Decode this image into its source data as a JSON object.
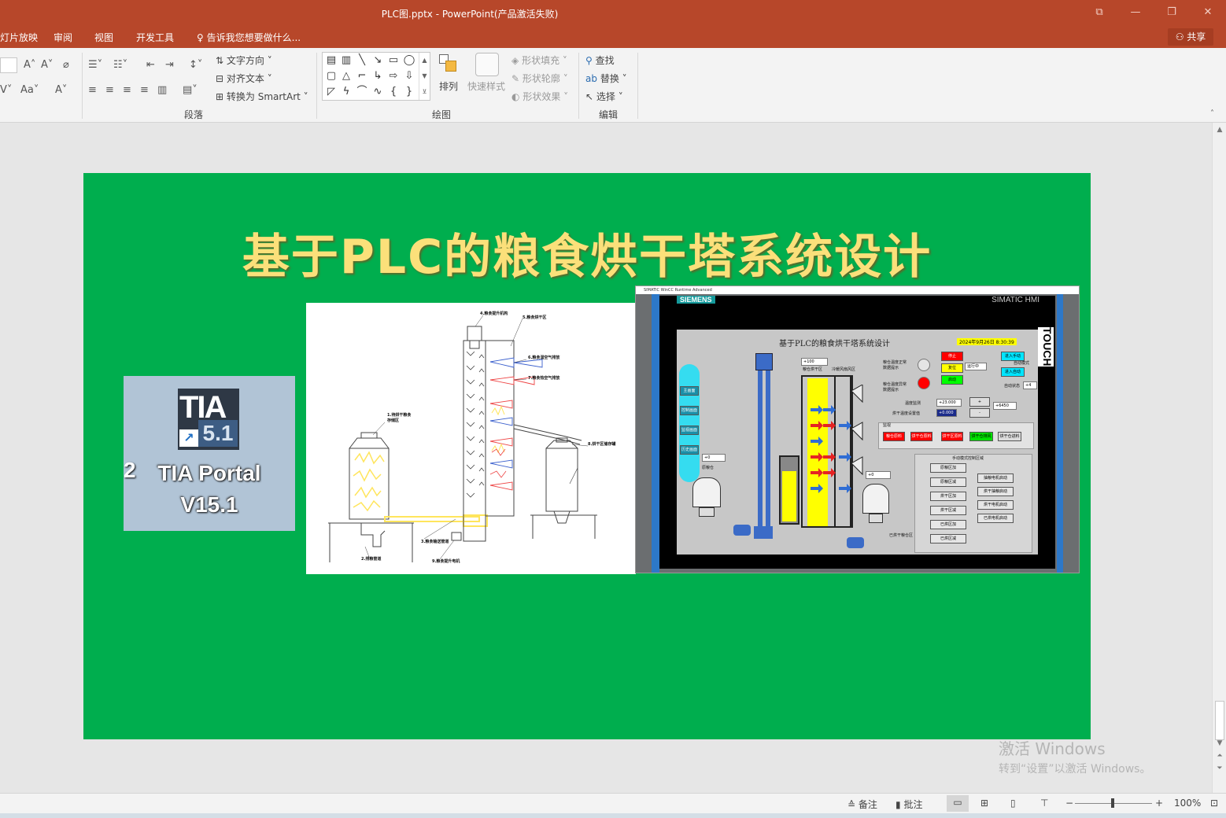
{
  "window": {
    "title": "PLC图.pptx - PowerPoint(产品激活失败)",
    "controls": [
      "⧉",
      "—",
      "❐",
      "✕"
    ]
  },
  "menu": {
    "tabs": [
      "幻灯片放映",
      "审阅",
      "视图",
      "开发工具"
    ],
    "tell_me": "告诉我您想要做什么...",
    "share": "共享"
  },
  "ribbon": {
    "paragraph": {
      "text_direction": "文字方向",
      "align_text": "对齐文本",
      "smartart": "转换为 SmartArt",
      "group_label": "段落"
    },
    "drawing": {
      "arrange": "排列",
      "quick_styles": "快速样式",
      "shape_fill": "形状填充",
      "shape_outline": "形状轮廓",
      "shape_effects": "形状效果",
      "group_label": "绘图"
    },
    "editing": {
      "find": "查找",
      "replace": "替换",
      "select": "选择",
      "group_label": "编辑"
    }
  },
  "slide": {
    "title": "基于PLC的粮食烘干塔系统设计",
    "tia": {
      "logo_text": "TIA",
      "logo_version": "5.1",
      "label_line1": "TIA Portal",
      "label_line2": "V15.1",
      "left_char": "2"
    },
    "diagram_labels": {
      "l4": "4.粮食提升机构",
      "l5": "5.粮食烘干区",
      "l6": "6.粮食湿空气排放",
      "l7": "7.粮食热空气排放",
      "l1a": "1.待烘干粮食",
      "l1b": "存储区",
      "l8": "8.烘干区储存罐",
      "l3": "3.粮食输送管道",
      "l2": "2.排粮管道",
      "l9": "9.粮食提升电机"
    },
    "hmi": {
      "window_title": "SIMATIC WinCC Runtime Advanced",
      "siemens": "SIEMENS",
      "simatic": "SIMATIC HMI",
      "touch": "TOUCH",
      "screen_title": "基于PLC的粮食烘干塔系统设计",
      "datetime": "2024年9月26日 8:30:39",
      "nav": [
        "主画面",
        "控制画面",
        "监视画面",
        "历史画面"
      ],
      "field_top": "+100",
      "zone_label": "粮仓烘干区",
      "fan_label": "冷暖风扇风区",
      "temp_normal": "粮仓温度正常",
      "temp_normal2": "数据提示",
      "temp_abnormal": "粮仓温度异常",
      "temp_abnormal2": "数据提示",
      "btn_stop": "停止",
      "btn_reset": "复位",
      "btn_start": "启动",
      "run_status": "运行中",
      "btn_manual": "进入手动",
      "btn_auto": "进入自动",
      "auto_mode": "自动模式",
      "auto_status": "自动状态",
      "auto_value": "+4",
      "temp_measure": "温度监测",
      "temp_value": "+23.000",
      "temp_set_label": "烘干温度设置值",
      "temp_set_value": "+0.000",
      "plus": "+",
      "minus": "-",
      "count_value": "+6450",
      "monitor": "监视",
      "status_btns": [
        "粮仓原料",
        "烘干仓原料",
        "烘干区原料",
        "烘干仓排风",
        "烘干仓进料"
      ],
      "left_field": "+0",
      "raw_silo": "原粮仓",
      "mid_field": "+0",
      "dried_silo": "已烘干粮仓区",
      "manual_area": "手动模式控制区域",
      "manual_left": [
        "原粮区加",
        "原粮区减",
        "烘干区加",
        "烘干区减",
        "已烘区加",
        "已烘区减"
      ],
      "manual_right": [
        "抽粮电机启动",
        "烘干抽粮启动",
        "烘干电机启动",
        "已烘电机启动"
      ]
    }
  },
  "statusbar": {
    "notes": "备注",
    "comments": "批注",
    "zoom": "100%"
  },
  "activation": {
    "line1": "激活 Windows",
    "line2": "转到“设置”以激活 Windows。"
  },
  "colors": {
    "title_bar": "#b7472a",
    "slide_bg": "#00ae4e",
    "slide_title": "#fbe07a"
  }
}
